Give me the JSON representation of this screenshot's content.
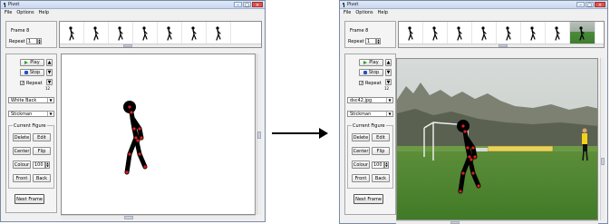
{
  "app": {
    "title": "Pivot",
    "menu": [
      "File",
      "Options",
      "Help"
    ]
  },
  "left": {
    "frame_label": "Frame 8",
    "repeat_label": "Repeat",
    "repeat_value": "1",
    "play_label": "Play",
    "stop_label": "Stop",
    "repeat_check_label": "Repeat",
    "speed_value": "12",
    "background_select": "White Back",
    "figure_select": "Stickman",
    "current_figure_label": "Current Figure",
    "delete_label": "Delete",
    "edit_label": "Edit",
    "center_label": "Center",
    "flip_label": "Flip",
    "colour_label": "Colour",
    "colour_value": "100",
    "front_label": "Front",
    "back_label": "Back",
    "next_frame_label": "Next Frame"
  },
  "right": {
    "frame_label": "Frame 8",
    "repeat_label": "Repeat",
    "repeat_value": "1",
    "play_label": "Play",
    "stop_label": "Stop",
    "repeat_check_label": "Repeat",
    "speed_value": "12",
    "background_select": "dsc42.jpg",
    "figure_select": "Stickman",
    "current_figure_label": "Current Figure",
    "delete_label": "Delete",
    "edit_label": "Edit",
    "center_label": "Center",
    "flip_label": "Flip",
    "colour_label": "Colour",
    "colour_value": "100",
    "front_label": "Front",
    "back_label": "Back",
    "next_frame_label": "Next Frame"
  },
  "icons": {
    "window_controls": [
      "minimize-icon",
      "maximize-icon",
      "close-icon"
    ],
    "play": "play-icon",
    "stop": "stop-icon",
    "arrow": "right-arrow-icon"
  },
  "colors": {
    "joint": "#e02020",
    "figure": "#000000",
    "play": "#2aa02a",
    "stop": "#2251c9"
  }
}
